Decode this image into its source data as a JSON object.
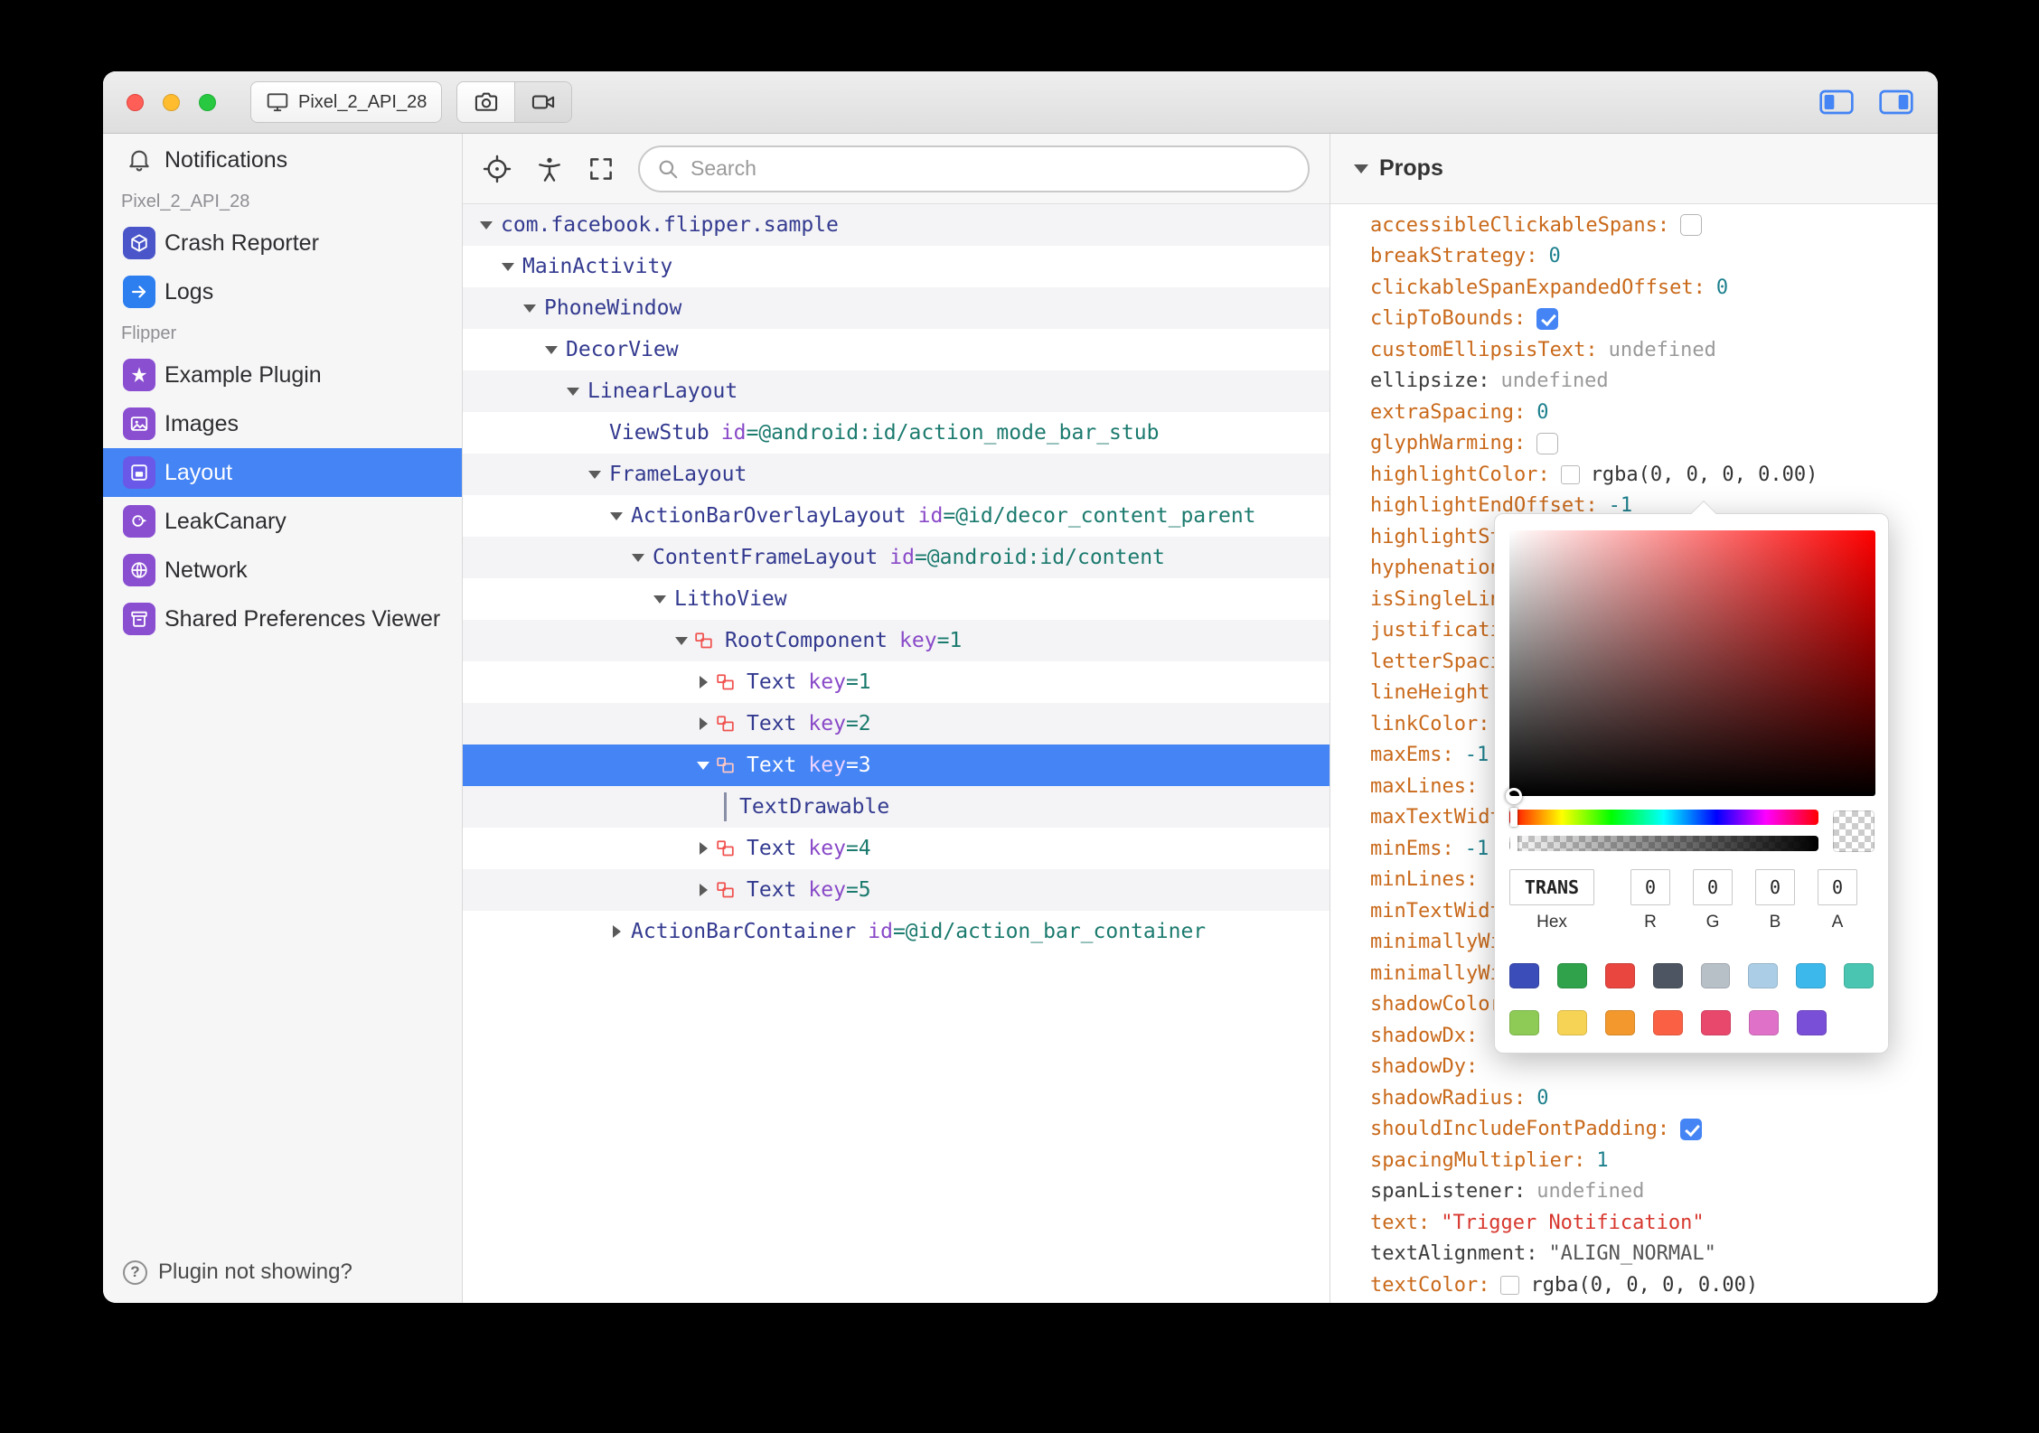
{
  "titlebar": {
    "device_label": "Pixel_2_API_28"
  },
  "search": {
    "placeholder": "Search"
  },
  "sidebar": {
    "entries": [
      {
        "kind": "item",
        "id": "notifications",
        "label": "Notifications",
        "icon": "bell-icon",
        "plain": true
      },
      {
        "kind": "header",
        "label": "Pixel_2_API_28"
      },
      {
        "kind": "item",
        "id": "crash-reporter",
        "label": "Crash Reporter",
        "icon": "cube-icon",
        "icon_bg": "#4a55c9"
      },
      {
        "kind": "item",
        "id": "logs",
        "label": "Logs",
        "icon": "arrow-right-icon",
        "icon_bg": "#2d7ff0"
      },
      {
        "kind": "header",
        "label": "Flipper"
      },
      {
        "kind": "item",
        "id": "example-plugin",
        "label": "Example Plugin",
        "icon": "star-icon",
        "icon_bg": "#8a4fd1"
      },
      {
        "kind": "item",
        "id": "images",
        "label": "Images",
        "icon": "photo-icon",
        "icon_bg": "#8a4fd1"
      },
      {
        "kind": "item",
        "id": "layout",
        "label": "Layout",
        "icon": "layout-icon",
        "icon_bg": "#6a59e8",
        "selected": true
      },
      {
        "kind": "item",
        "id": "leakcanary",
        "label": "LeakCanary",
        "icon": "bird-icon",
        "icon_bg": "#8a4fd1"
      },
      {
        "kind": "item",
        "id": "network",
        "label": "Network",
        "icon": "globe-icon",
        "icon_bg": "#8a4fd1"
      },
      {
        "kind": "item",
        "id": "shared-preferences-viewer",
        "label": "Shared Preferences Viewer",
        "icon": "box-icon",
        "icon_bg": "#8a4fd1"
      }
    ],
    "footer_label": "Plugin not showing?"
  },
  "tree": {
    "rows": [
      {
        "depth": 0,
        "arrow": "down",
        "name": "com.facebook.flipper.sample"
      },
      {
        "depth": 1,
        "arrow": "down",
        "name": "MainActivity"
      },
      {
        "depth": 2,
        "arrow": "down",
        "name": "PhoneWindow"
      },
      {
        "depth": 3,
        "arrow": "down",
        "name": "DecorView"
      },
      {
        "depth": 4,
        "arrow": "down",
        "name": "LinearLayout"
      },
      {
        "depth": 5,
        "arrow": "none",
        "name": "ViewStub",
        "attr_key": "id",
        "attr_value": "=@android:id/action_mode_bar_stub"
      },
      {
        "depth": 5,
        "arrow": "down",
        "name": "FrameLayout"
      },
      {
        "depth": 6,
        "arrow": "down",
        "name": "ActionBarOverlayLayout",
        "attr_key": "id",
        "attr_value": "=@id/decor_content_parent"
      },
      {
        "depth": 7,
        "arrow": "down",
        "name": "ContentFrameLayout",
        "attr_key": "id",
        "attr_value": "=@android:id/content"
      },
      {
        "depth": 8,
        "arrow": "down",
        "name": "LithoView"
      },
      {
        "depth": 9,
        "arrow": "down",
        "litho": true,
        "name": "RootComponent",
        "attr_key": "key",
        "attr_value": "=1"
      },
      {
        "depth": 10,
        "arrow": "right",
        "litho": true,
        "name": "Text",
        "attr_key": "key",
        "attr_value": "=1"
      },
      {
        "depth": 10,
        "arrow": "right",
        "litho": true,
        "name": "Text",
        "attr_key": "key",
        "attr_value": "=2"
      },
      {
        "depth": 10,
        "arrow": "down",
        "litho": true,
        "name": "Text",
        "attr_key": "key",
        "attr_value": "=3",
        "selected": true
      },
      {
        "depth": 11,
        "arrow": "guide",
        "name": "TextDrawable"
      },
      {
        "depth": 10,
        "arrow": "right",
        "litho": true,
        "name": "Text",
        "attr_key": "key",
        "attr_value": "=4"
      },
      {
        "depth": 10,
        "arrow": "right",
        "litho": true,
        "name": "Text",
        "attr_key": "key",
        "attr_value": "=5"
      },
      {
        "depth": 6,
        "arrow": "right",
        "name": "ActionBarContainer",
        "attr_key": "id",
        "attr_value": "=@id/action_bar_container"
      }
    ]
  },
  "props": {
    "title": "Props",
    "rows": [
      {
        "key": "accessibleClickableSpans",
        "key_style": "orange",
        "checkbox": "unchecked"
      },
      {
        "key": "breakStrategy",
        "key_style": "orange",
        "value": "0",
        "value_style": "num"
      },
      {
        "key": "clickableSpanExpandedOffset",
        "key_style": "orange",
        "value": "0",
        "value_style": "num"
      },
      {
        "key": "clipToBounds",
        "key_style": "orange",
        "checkbox": "checked"
      },
      {
        "key": "customEllipsisText",
        "key_style": "orange",
        "value": "undefined",
        "value_style": "undef"
      },
      {
        "key": "ellipsize",
        "key_style": "plain",
        "value": "undefined",
        "value_style": "undef"
      },
      {
        "key": "extraSpacing",
        "key_style": "orange",
        "value": "0",
        "value_style": "num"
      },
      {
        "key": "glyphWarming",
        "key_style": "orange",
        "checkbox": "unchecked"
      },
      {
        "key": "highlightColor",
        "key_style": "orange",
        "colorbox": true,
        "value": "rgba(0, 0, 0, 0.00)",
        "value_style": "rgba"
      },
      {
        "key": "highlightEndOffset",
        "key_style": "orange",
        "value": "-1",
        "value_style": "num"
      },
      {
        "key": "highlightStartOffset",
        "key_style": "orange"
      },
      {
        "key": "hyphenationFrequency",
        "key_style": "orange"
      },
      {
        "key": "isSingleLine",
        "key_style": "orange"
      },
      {
        "key": "justificationMode",
        "key_style": "orange"
      },
      {
        "key": "letterSpacing",
        "key_style": "orange"
      },
      {
        "key": "lineHeight",
        "key_style": "orange"
      },
      {
        "key": "linkColor",
        "key_style": "orange"
      },
      {
        "key": "maxEms",
        "key_style": "orange",
        "value": "-1",
        "value_style": "num"
      },
      {
        "key": "maxLines",
        "key_style": "orange"
      },
      {
        "key": "maxTextWidth",
        "key_style": "orange"
      },
      {
        "key": "minEms",
        "key_style": "orange",
        "value": "-1",
        "value_style": "num"
      },
      {
        "key": "minLines",
        "key_style": "orange"
      },
      {
        "key": "minTextWidth",
        "key_style": "orange"
      },
      {
        "key": "minimallyWide",
        "key_style": "orange"
      },
      {
        "key": "minimallyWideThreshold",
        "key_style": "orange"
      },
      {
        "key": "shadowColor",
        "key_style": "orange"
      },
      {
        "key": "shadowDx",
        "key_style": "orange"
      },
      {
        "key": "shadowDy",
        "key_style": "orange"
      },
      {
        "key": "shadowRadius",
        "key_style": "orange",
        "value": "0",
        "value_style": "num"
      },
      {
        "key": "shouldIncludeFontPadding",
        "key_style": "orange",
        "checkbox": "checked"
      },
      {
        "key": "spacingMultiplier",
        "key_style": "orange",
        "value": "1",
        "value_style": "num"
      },
      {
        "key": "spanListener",
        "key_style": "plain",
        "value": "undefined",
        "value_style": "undef"
      },
      {
        "key": "text",
        "key_style": "orange",
        "value": "\"Trigger Notification\"",
        "value_style": "str"
      },
      {
        "key": "textAlignment",
        "key_style": "plain",
        "value": "\"ALIGN_NORMAL\"",
        "value_style": "strd"
      },
      {
        "key": "textColor",
        "key_style": "orange",
        "colorbox": true,
        "value": "rgba(0, 0, 0, 0.00)",
        "value_style": "rgba"
      }
    ]
  },
  "color_picker": {
    "hex": "TRANS",
    "r": "0",
    "g": "0",
    "b": "0",
    "a": "0",
    "labels": {
      "hex": "Hex",
      "r": "R",
      "g": "G",
      "b": "B",
      "a": "A"
    },
    "swatches": [
      [
        "#3b4db8",
        "#2fa24b",
        "#e8463f",
        "#4c5561",
        "#b7bfc7",
        "#abcee6",
        "#3cb8ea",
        "#49c5b1"
      ],
      [
        "#8ecb56",
        "#f6d354",
        "#f2982d",
        "#fa6144",
        "#e9486d",
        "#df72c8",
        "#7a4fd7"
      ]
    ]
  },
  "colors": {
    "accent": "#4484f4",
    "litho_icon": "#f0524f",
    "tree_name": "#333a8f",
    "tree_attr_key": "#8949c8",
    "tree_attr_value": "#1b7a6e",
    "prop_key": "#c9691a",
    "prop_number": "#1d808d",
    "prop_string": "#d7382e",
    "picker_base": "#ff0000"
  }
}
